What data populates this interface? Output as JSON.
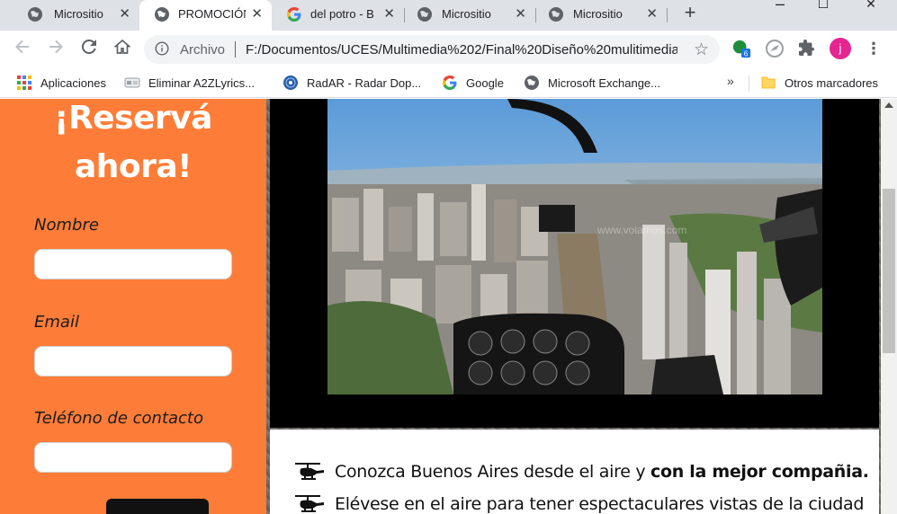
{
  "tabs": [
    {
      "title": "Micrositio",
      "favicon": "globe-icon",
      "active": false
    },
    {
      "title": "PROMOCIÓN",
      "favicon": "globe-icon",
      "active": true
    },
    {
      "title": "del potro - B",
      "favicon": "google-icon",
      "active": false
    },
    {
      "title": "Micrositio",
      "favicon": "globe-icon",
      "active": false
    },
    {
      "title": "Micrositio",
      "favicon": "globe-icon",
      "active": false
    }
  ],
  "window_controls": {
    "minimize": "–",
    "maximize": "☐",
    "close": "✕"
  },
  "omnibox": {
    "scheme": "Archivo",
    "url": "F:/Documentos/UCES/Multimedia%202/Final%20Diseño%20mulitimedia..."
  },
  "extensions": {
    "badge_count": "6"
  },
  "profile": {
    "initial": "j",
    "color": "#e52592"
  },
  "bookmarks": [
    {
      "label": "Aplicaciones",
      "icon": "apps-grid-icon"
    },
    {
      "label": "Eliminar A2ZLyrics...",
      "icon": "puzzle-icon"
    },
    {
      "label": "RadAR - Radar Dop...",
      "icon": "radar-icon"
    },
    {
      "label": "Google",
      "icon": "google-icon"
    },
    {
      "label": "Microsoft Exchange...",
      "icon": "globe-icon"
    }
  ],
  "bookmarks_more": "»",
  "other_bookmarks": "Otros marcadores",
  "form": {
    "heading_line1": "¡Reservá",
    "heading_line2": "ahora!",
    "fields": [
      {
        "label": "Nombre",
        "value": ""
      },
      {
        "label": "Email",
        "value": ""
      },
      {
        "label": "Teléfono de contacto",
        "value": ""
      }
    ]
  },
  "hero": {
    "watermark": "www.volamos.com"
  },
  "features": [
    {
      "text": "Conozca Buenos Aires desde el aire y ",
      "bold": "con la mejor compañia."
    },
    {
      "text": "Elévese en el aire para tener espectaculares vistas de la ciudad",
      "bold": ""
    }
  ],
  "colors": {
    "accent": "#fd7d38",
    "tab_strip": "#dee1e6"
  }
}
